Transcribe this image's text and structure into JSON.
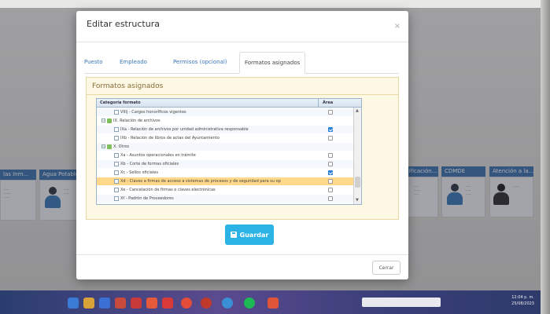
{
  "modal": {
    "title": "Editar estructura",
    "close_symbol": "×",
    "tabs": [
      {
        "label": "Puesto",
        "active": false
      },
      {
        "label": "Empleado",
        "active": false
      },
      {
        "label": "Permisos (opcional)",
        "active": false
      },
      {
        "label": "Formatos asignados",
        "active": true
      }
    ],
    "panel_title": "Formatos asignados",
    "grid": {
      "columns": [
        "Categoría formato",
        "Área"
      ],
      "rows": [
        {
          "text": "VIIIj - Cargos honoríficos vigentes",
          "type": "doc",
          "checked": false
        },
        {
          "text": "IX. Relación de archivos",
          "type": "folder",
          "checked": null
        },
        {
          "text": "IXa - Relación de archivos por unidad administrativa responsable",
          "type": "doc",
          "checked": true
        },
        {
          "text": "IXb - Relación de libros de actas del Ayuntamiento",
          "type": "doc",
          "checked": false
        },
        {
          "text": "X. Otros",
          "type": "folder",
          "checked": null
        },
        {
          "text": "Xa - Asuntos operacionales en trámite",
          "type": "doc",
          "checked": false
        },
        {
          "text": "Xb - Corte de formas oficiales",
          "type": "doc",
          "checked": false
        },
        {
          "text": "Xc - Sellos oficiales",
          "type": "doc",
          "checked": true
        },
        {
          "text": "Xd - Claves a firmas de acceso a sistemas de procesos y de seguridad para su op",
          "type": "doc",
          "checked": false
        },
        {
          "text": "Xe - Cancelación de firmas o claves electrónicas",
          "type": "doc",
          "checked": false
        },
        {
          "text": "Xf - Padrón de Proveedores",
          "type": "doc",
          "checked": false
        }
      ],
      "selected_row": 8
    },
    "save_label": "Guardar",
    "close_label": "Cerrar"
  },
  "background": {
    "org_titles": [
      "las Inm...",
      "Agua Potable y...",
      "...ificación...",
      "CDMDE",
      "Atención a la..."
    ],
    "colors": {
      "org_bar": "#2f6aa8",
      "accent": "#2bb3e6",
      "check": "#2a7fd6"
    }
  },
  "taskbar": {
    "clock_time": "12:04 p. m.",
    "clock_date": "25/08/2023"
  }
}
